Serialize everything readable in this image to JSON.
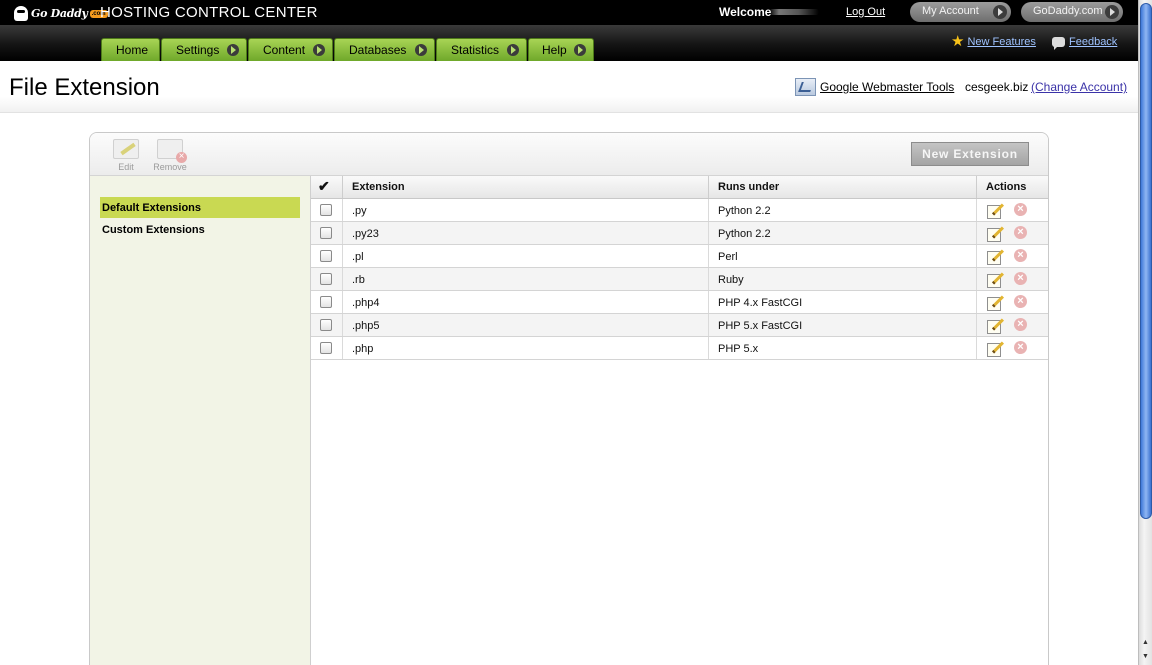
{
  "header": {
    "logo_text": "Go Daddy",
    "logo_suffix": ".com",
    "app_title": "HOSTING CONTROL CENTER",
    "welcome": "Welcome",
    "logout": "Log Out",
    "my_account": "My Account",
    "godaddy_com": "GoDaddy.com"
  },
  "nav": {
    "tabs": [
      {
        "label": "Home"
      },
      {
        "label": "Settings"
      },
      {
        "label": "Content"
      },
      {
        "label": "Databases"
      },
      {
        "label": "Statistics"
      },
      {
        "label": "Help"
      }
    ],
    "new_features": "New Features",
    "feedback": "Feedback"
  },
  "page": {
    "title": "File Extension",
    "google_webmaster_tools": "Google Webmaster Tools",
    "account_domain": "cesgeek.biz",
    "change_account": "(Change Account)"
  },
  "toolbar": {
    "edit": "Edit",
    "remove": "Remove",
    "new_extension": "New Extension"
  },
  "sidebar": {
    "items": [
      {
        "label": "Default Extensions",
        "selected": true
      },
      {
        "label": "Custom Extensions",
        "selected": false
      }
    ]
  },
  "grid": {
    "columns": {
      "check": "✔",
      "extension": "Extension",
      "runs_under": "Runs under",
      "actions": "Actions"
    },
    "rows": [
      {
        "extension": ".py",
        "runs_under": "Python 2.2"
      },
      {
        "extension": ".py23",
        "runs_under": "Python 2.2"
      },
      {
        "extension": ".pl",
        "runs_under": "Perl"
      },
      {
        "extension": ".rb",
        "runs_under": "Ruby"
      },
      {
        "extension": ".php4",
        "runs_under": "PHP 4.x FastCGI"
      },
      {
        "extension": ".php5",
        "runs_under": "PHP 5.x FastCGI"
      },
      {
        "extension": ".php",
        "runs_under": "PHP 5.x"
      }
    ]
  },
  "icons": {
    "star": "star-icon",
    "feedback": "speech-bubble-icon",
    "edit_action": "pencil-icon",
    "remove_action": "x-circle-icon"
  },
  "colors": {
    "tab_green": "#8cc43d",
    "sidebar_selected": "#c9d952",
    "sidebar_bg": "#f2f4e6",
    "link_blue": "#3b33a8"
  }
}
